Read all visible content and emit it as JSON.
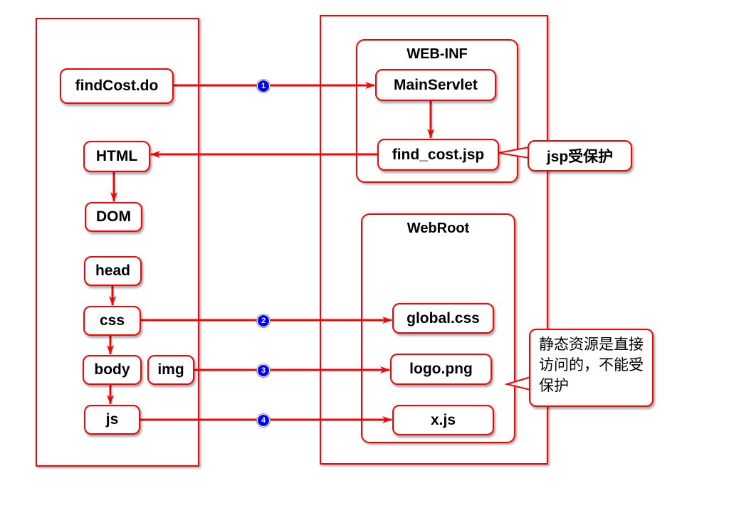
{
  "colors": {
    "stroke": "#ff0000",
    "badge": "#0000ff"
  },
  "groups": {
    "web_inf": "WEB-INF",
    "web_root": "WebRoot"
  },
  "nodes": {
    "find_cost_do": "findCost.do",
    "html": "HTML",
    "dom": "DOM",
    "head": "head",
    "css": "css",
    "body": "body",
    "img": "img",
    "js": "js",
    "main_servlet": "MainServlet",
    "find_cost_jsp": "find_cost.jsp",
    "global_css": "global.css",
    "logo_png": "logo.png",
    "x_js": "x.js"
  },
  "callouts": {
    "jsp_protected": "jsp受保护",
    "static_resources": "静态资源是直接访问的，不能受保护"
  },
  "badges": [
    "1",
    "2",
    "3",
    "4"
  ]
}
